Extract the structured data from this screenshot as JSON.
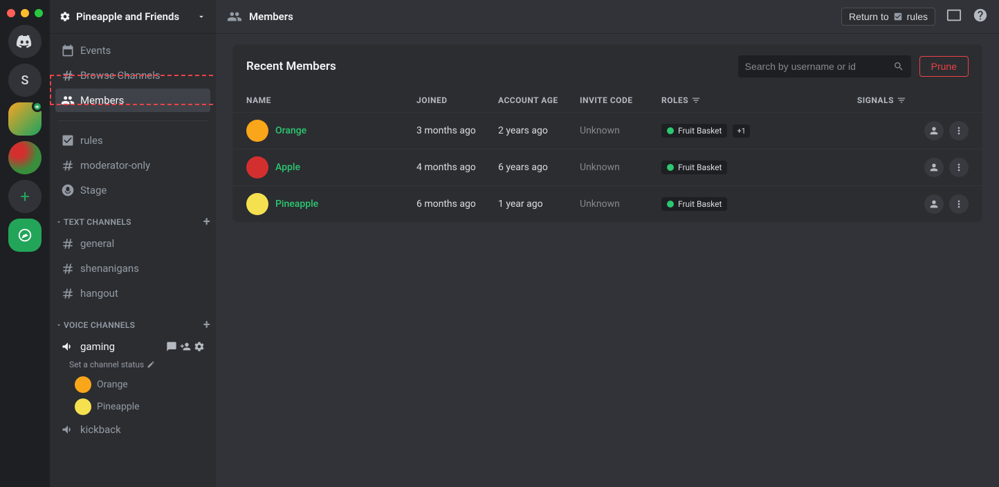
{
  "server": {
    "name": "Pineapple and Friends",
    "letter": "S"
  },
  "sidebar": {
    "events": "Events",
    "browse": "Browse Channels",
    "members": "Members",
    "rules": "rules",
    "mod": "moderator-only",
    "stage": "Stage",
    "cat_text": "TEXT CHANNELS",
    "general": "general",
    "shen": "shenanigans",
    "hangout": "hangout",
    "cat_voice": "VOICE CHANNELS",
    "gaming": "gaming",
    "gaming_status": "Set a channel status",
    "vm1": "Orange",
    "vm2": "Pineapple",
    "kickback": "kickback"
  },
  "header": {
    "title": "Members",
    "return_prefix": "Return to",
    "return_channel": "rules"
  },
  "panel": {
    "title": "Recent Members",
    "search_placeholder": "Search by username or id",
    "prune": "Prune"
  },
  "columns": {
    "name": "NAME",
    "joined": "JOINED",
    "age": "ACCOUNT AGE",
    "invite": "INVITE CODE",
    "roles": "ROLES",
    "signals": "SIGNALS"
  },
  "members": [
    {
      "name": "Orange",
      "joined": "3 months ago",
      "age": "2 years ago",
      "invite": "Unknown",
      "role": "Fruit Basket",
      "extra": "+1",
      "avatar": "#faa61a"
    },
    {
      "name": "Apple",
      "joined": "4 months ago",
      "age": "6 years ago",
      "invite": "Unknown",
      "role": "Fruit Basket",
      "extra": "",
      "avatar": "#d32f2f"
    },
    {
      "name": "Pineapple",
      "joined": "6 months ago",
      "age": "1 year ago",
      "invite": "Unknown",
      "role": "Fruit Basket",
      "extra": "",
      "avatar": "#f5e050"
    }
  ]
}
